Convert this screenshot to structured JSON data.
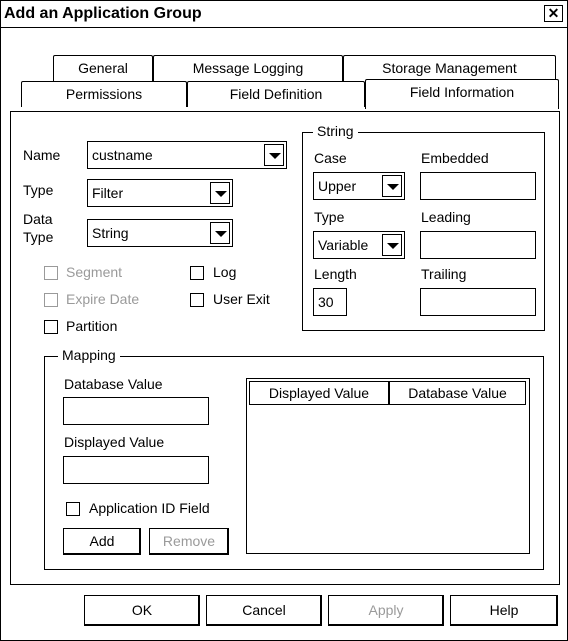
{
  "window": {
    "title": "Add an Application Group",
    "close_glyph": "✕"
  },
  "tabs": {
    "row_back": [
      "General",
      "Message Logging",
      "Storage Management"
    ],
    "row_front": [
      "Permissions",
      "Field Definition",
      "Field Information"
    ],
    "active": "Field Information"
  },
  "form": {
    "name_label": "Name",
    "name_value": "custname",
    "type_label": "Type",
    "type_value": "Filter",
    "data_type_label_1": "Data",
    "data_type_label_2": "Type",
    "data_type_value": "String"
  },
  "checkboxes": {
    "segment": "Segment",
    "expire_date": "Expire Date",
    "partition": "Partition",
    "log": "Log",
    "user_exit": "User Exit"
  },
  "string_group": {
    "title": "String",
    "case_label": "Case",
    "case_value": "Upper",
    "embedded_label": "Embedded",
    "embedded_value": "",
    "type_label": "Type",
    "type_value": "Variable",
    "leading_label": "Leading",
    "leading_value": "",
    "length_label": "Length",
    "length_value": "30",
    "trailing_label": "Trailing",
    "trailing_value": ""
  },
  "mapping": {
    "title": "Mapping",
    "database_value_label": "Database Value",
    "database_value": "",
    "displayed_value_label": "Displayed Value",
    "displayed_value": "",
    "app_id_label": "Application ID Field",
    "add_label": "Add",
    "remove_label": "Remove",
    "columns": [
      "Displayed Value",
      "Database Value"
    ]
  },
  "footer": {
    "ok": "OK",
    "cancel": "Cancel",
    "apply": "Apply",
    "help": "Help"
  },
  "colors": {
    "disabled_text": "#9a9a9a",
    "border": "#000000",
    "background": "#ffffff"
  }
}
